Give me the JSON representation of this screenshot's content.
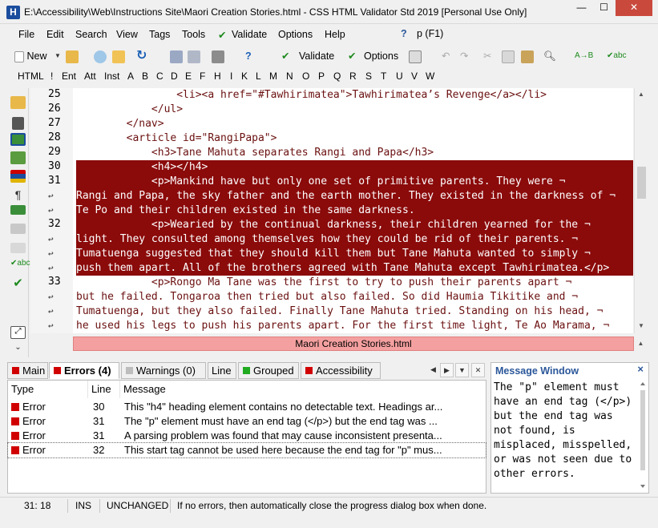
{
  "window": {
    "title": "E:\\Accessibility\\Web\\Instructions Site\\Maori Creation Stories.html - CSS HTML Validator Std 2019 [Personal Use Only]",
    "app_icon_letter": "H",
    "minimize": "—",
    "maximize": "☐",
    "close": "✕"
  },
  "menu": {
    "items": [
      "File",
      "Edit",
      "Search",
      "View",
      "Tags",
      "Tools",
      "Validate",
      "Options",
      "Help"
    ],
    "help_context": "p (F1)"
  },
  "toolbar": {
    "new_label": "New",
    "validate_label": "Validate",
    "options_label": "Options"
  },
  "tagbar": {
    "items": [
      "HTML",
      "!",
      "Ent",
      "Att",
      "Inst",
      "A",
      "B",
      "C",
      "D",
      "E",
      "F",
      "H",
      "I",
      "K",
      "L",
      "M",
      "N",
      "O",
      "P",
      "Q",
      "R",
      "S",
      "T",
      "U",
      "V",
      "W"
    ]
  },
  "editor": {
    "gutter": [
      "25",
      "26",
      "27",
      "28",
      "29",
      "30",
      "31",
      "",
      "",
      "32",
      "",
      "",
      "",
      "33",
      "",
      "",
      ""
    ],
    "lines": [
      "                <li><a href=\"#Tawhirimatea\">Tawhirimatea’s Revenge</a></li>",
      "            </ul>",
      "        </nav>",
      "        <article id=\"RangiPapa\">",
      "            <h3>Tane Mahuta separates Rangi and Papa</h3>",
      "            <h4></h4>",
      "            <p>Mankind have but only one set of primitive parents. They were ¬",
      "Rangi and Papa, the sky father and the earth mother. They existed in the darkness of ¬",
      "Te Po and their children existed in the same darkness.",
      "            <p>Wearied by the continual darkness, their children yearned for the ¬",
      "light. They consulted among themselves how they could be rid of their parents. ¬",
      "Tumatuenga suggested that they should kill them but Tane Mahuta wanted to simply ¬",
      "push them apart. All of the brothers agreed with Tane Mahuta except Tawhirimatea.</p>",
      "            <p>Rongo Ma Tane was the first to try to push their parents apart ¬",
      "but he failed. Tongaroa then tried but also failed. So did Haumia Tikitike and ¬",
      "Tumatuenga, but they also failed. Finally Tane Mahuta tried. Standing on his head, ¬",
      "he used his legs to push his parents apart. For the first time light, Te Ao Marama, ¬"
    ],
    "file_tab": "Maori Creation Stories.html"
  },
  "tabs": {
    "main": "Main",
    "errors": "Errors (4)",
    "warnings": "Warnings (0)",
    "line": "Line",
    "grouped": "Grouped",
    "accessibility": "Accessibility"
  },
  "errors": {
    "headers": {
      "type": "Type",
      "line": "Line",
      "message": "Message"
    },
    "rows": [
      {
        "type": "Error",
        "line": "30",
        "message": "This \"h4\" heading element contains no detectable text. Headings ar..."
      },
      {
        "type": "Error",
        "line": "31",
        "message": "The \"p\" element must have an end tag (</p>) but the end tag was ..."
      },
      {
        "type": "Error",
        "line": "31",
        "message": "A parsing problem was found that may cause inconsistent presenta..."
      },
      {
        "type": "Error",
        "line": "32",
        "message": "This start tag cannot be used here because the end tag for \"p\" mus..."
      }
    ]
  },
  "message_window": {
    "title": "Message Window",
    "close": "×",
    "text": "The \"p\" element must have an end tag (</p>) but the end tag was not found, is misplaced, misspelled, or was not seen due to other errors."
  },
  "status": {
    "position": "31: 18",
    "mode": "INS",
    "state": "UNCHANGED",
    "message": "If no errors, then automatically close the progress dialog box when done."
  },
  "colors": {
    "selection": "#8b0a0a",
    "file_tab": "#f5a0a0",
    "error": "#d10000",
    "accent": "#2b579a"
  }
}
